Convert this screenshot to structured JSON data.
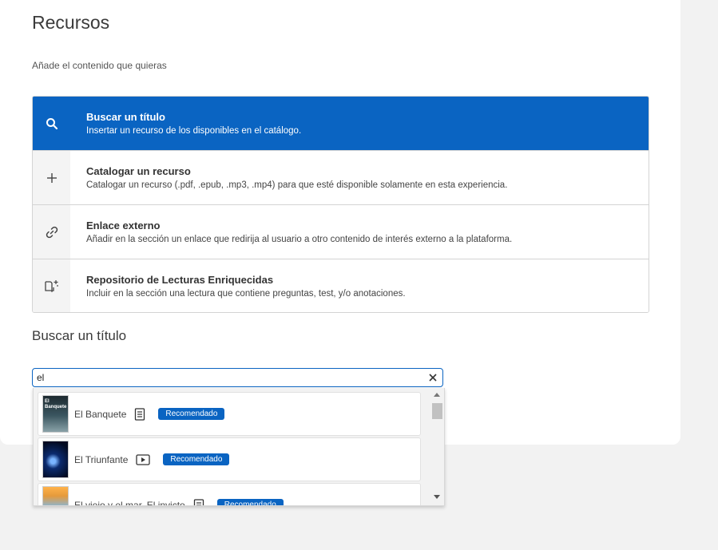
{
  "page": {
    "title": "Recursos",
    "subtitle": "Añade el contenido que quieras"
  },
  "options": [
    {
      "title": "Buscar un título",
      "description": "Insertar un recurso de los disponibles en el catálogo.",
      "icon": "search-icon",
      "active": true
    },
    {
      "title": "Catalogar un recurso",
      "description": "Catalogar un recurso (.pdf, .epub, .mp3, .mp4) para que esté disponible solamente en esta experiencia.",
      "icon": "plus-icon"
    },
    {
      "title": "Enlace externo",
      "description": "Añadir en la sección un enlace que redirija al usuario a otro contenido de interés externo a la plataforma.",
      "icon": "link-icon"
    },
    {
      "title": "Repositorio de Lecturas Enriquecidas",
      "description": "Incluir en la sección una lectura que contiene preguntas, test, y/o anotaciones.",
      "icon": "enriched-book-icon"
    }
  ],
  "search": {
    "section_title": "Buscar un título",
    "value": "el"
  },
  "results": [
    {
      "title": "El Banquete",
      "type_icon": "document-icon",
      "badge": "Recomendado",
      "cover_text": "El Banquete"
    },
    {
      "title": "El Triunfante",
      "type_icon": "video-icon",
      "badge": "Recomendado",
      "cover_text": ""
    },
    {
      "title": "El viejo y el mar. El invicto",
      "type_icon": "document-icon",
      "badge": "Recomendado",
      "cover_text": ""
    }
  ],
  "colors": {
    "accent": "#0a64c2",
    "background": "#f2f2f2"
  }
}
